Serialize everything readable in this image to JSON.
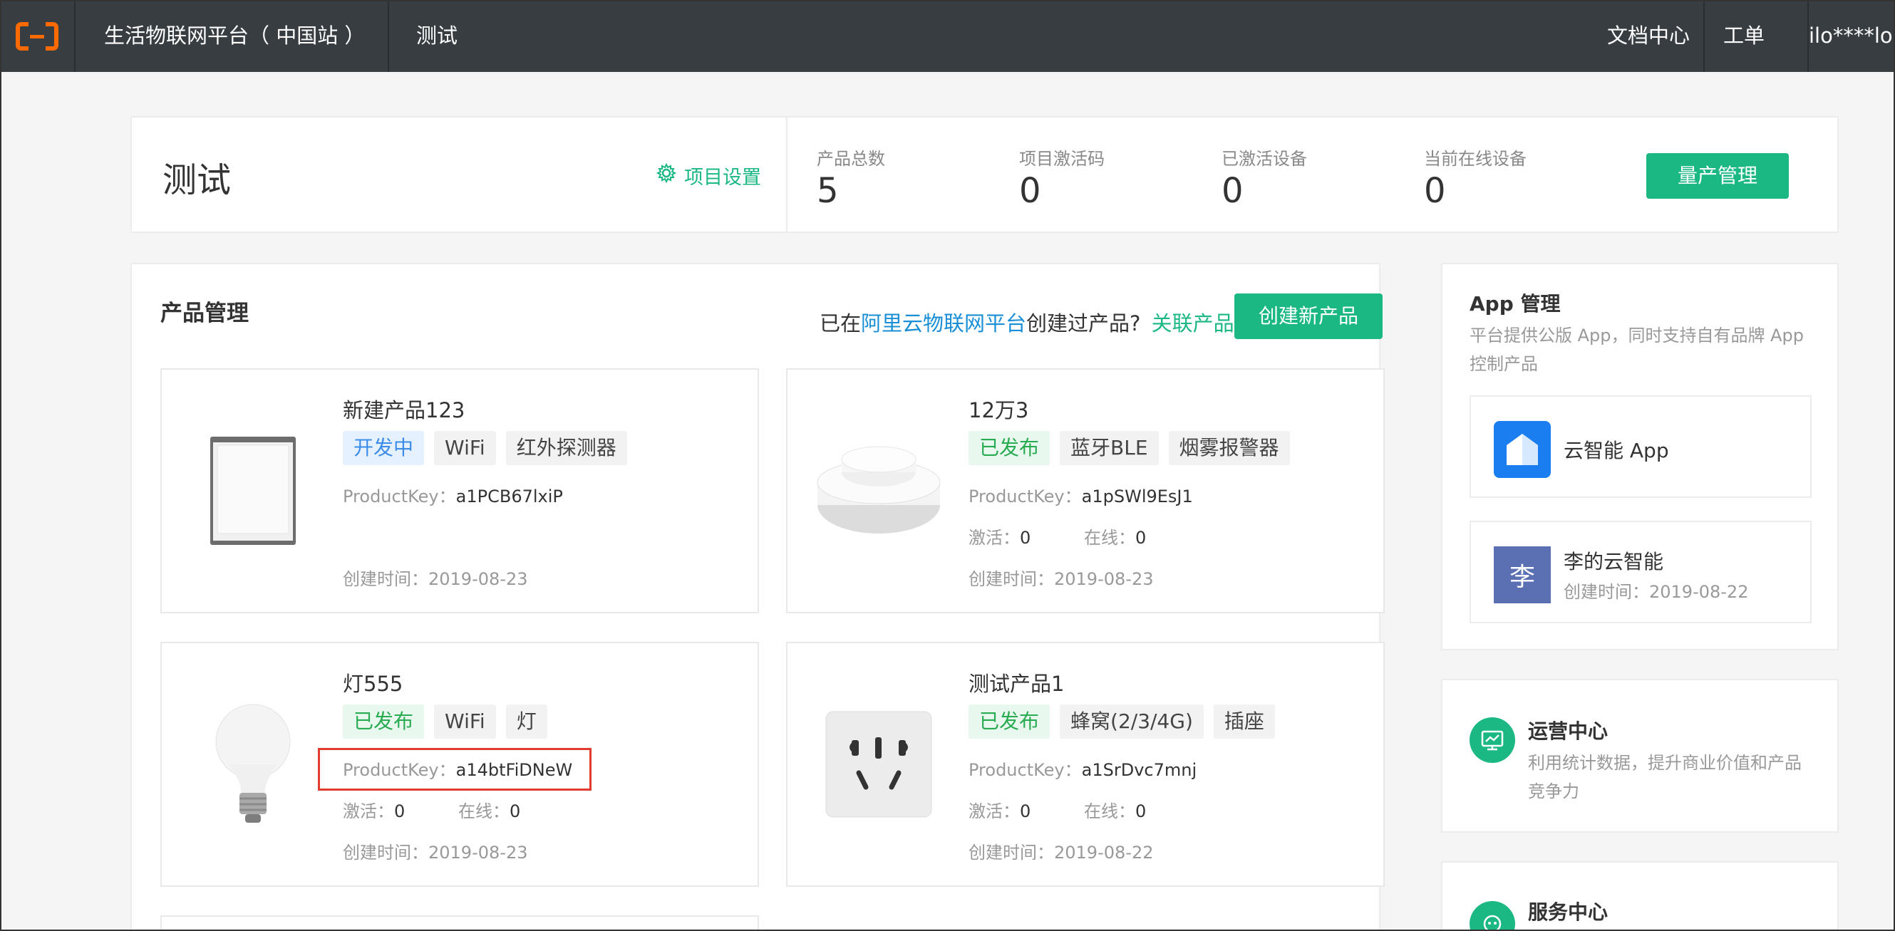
{
  "header": {
    "brand": "生活物联网平台（ 中国站 ）",
    "project": "测试",
    "docs": "文档中心",
    "tickets": "工单",
    "user": "ilo****lop"
  },
  "summary": {
    "title": "测试",
    "settings_label": "项目设置",
    "stats": [
      {
        "label": "产品总数",
        "value": "5"
      },
      {
        "label": "项目激活码",
        "value": "0"
      },
      {
        "label": "已激活设备",
        "value": "0"
      },
      {
        "label": "当前在线设备",
        "value": "0"
      }
    ],
    "mass_button": "量产管理"
  },
  "products": {
    "title": "产品管理",
    "hint_prefix": "已在",
    "hint_link": "阿里云物联网平台",
    "hint_mid": "创建过产品?",
    "hint_action": "关联产品",
    "create_button": "创建新产品",
    "key_label": "ProductKey：",
    "active_label": "激活：",
    "online_label": "在线：",
    "created_label": "创建时间：",
    "items": [
      {
        "name": "新建产品123",
        "status": "开发中",
        "protocol": "WiFi",
        "category": "红外探测器",
        "key": "a1PCB67lxiP",
        "active": "",
        "online": "",
        "created": "2019-08-23"
      },
      {
        "name": "12万3",
        "status": "已发布",
        "protocol": "蓝牙BLE",
        "category": "烟雾报警器",
        "key": "a1pSWl9EsJ1",
        "active": "0",
        "online": "0",
        "created": "2019-08-23"
      },
      {
        "name": "灯555",
        "status": "已发布",
        "protocol": "WiFi",
        "category": "灯",
        "key": "a14btFiDNeW",
        "active": "0",
        "online": "0",
        "created": "2019-08-23"
      },
      {
        "name": "测试产品1",
        "status": "已发布",
        "protocol": "蜂窝(2/3/4G)",
        "category": "插座",
        "key": "a1SrDvc7mnj",
        "active": "0",
        "online": "0",
        "created": "2019-08-22"
      }
    ]
  },
  "app_mgmt": {
    "title": "App 管理",
    "desc_line1": "平台提供公版 App，同时支持自有品牌 App",
    "desc_line2": "控制产品",
    "apps": [
      {
        "name": "云智能 App",
        "icon": "home-icon"
      },
      {
        "name": "李的云智能",
        "icon_text": "李",
        "date": "创建时间：2019-08-22"
      }
    ]
  },
  "ops": {
    "title": "运营中心",
    "desc_line1": "利用统计数据，提升商业价值和产品",
    "desc_line2": "竞争力"
  },
  "service": {
    "title": "服务中心"
  },
  "colors": {
    "accent": "#1bb884",
    "header_bg": "#373d41",
    "link_blue": "#1a8fd6",
    "highlight_red": "#e23c2f"
  }
}
